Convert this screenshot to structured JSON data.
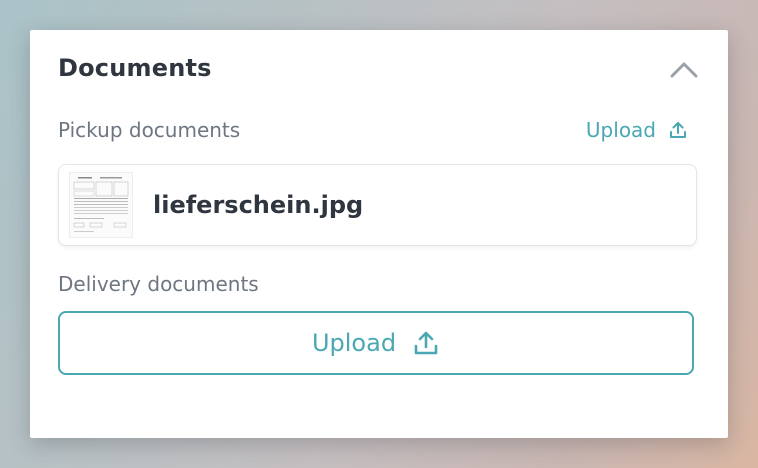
{
  "panel": {
    "title": "Documents",
    "collapse_icon": "chevron-up-icon"
  },
  "pickup": {
    "label": "Pickup documents",
    "upload_label": "Upload",
    "upload_icon": "upload-icon",
    "files": [
      {
        "name": "lieferschein.jpg"
      }
    ]
  },
  "delivery": {
    "label": "Delivery documents",
    "upload_label": "Upload",
    "upload_icon": "upload-icon"
  },
  "colors": {
    "accent": "#4aa8b2",
    "heading": "#2f3640",
    "muted": "#6d7681"
  }
}
